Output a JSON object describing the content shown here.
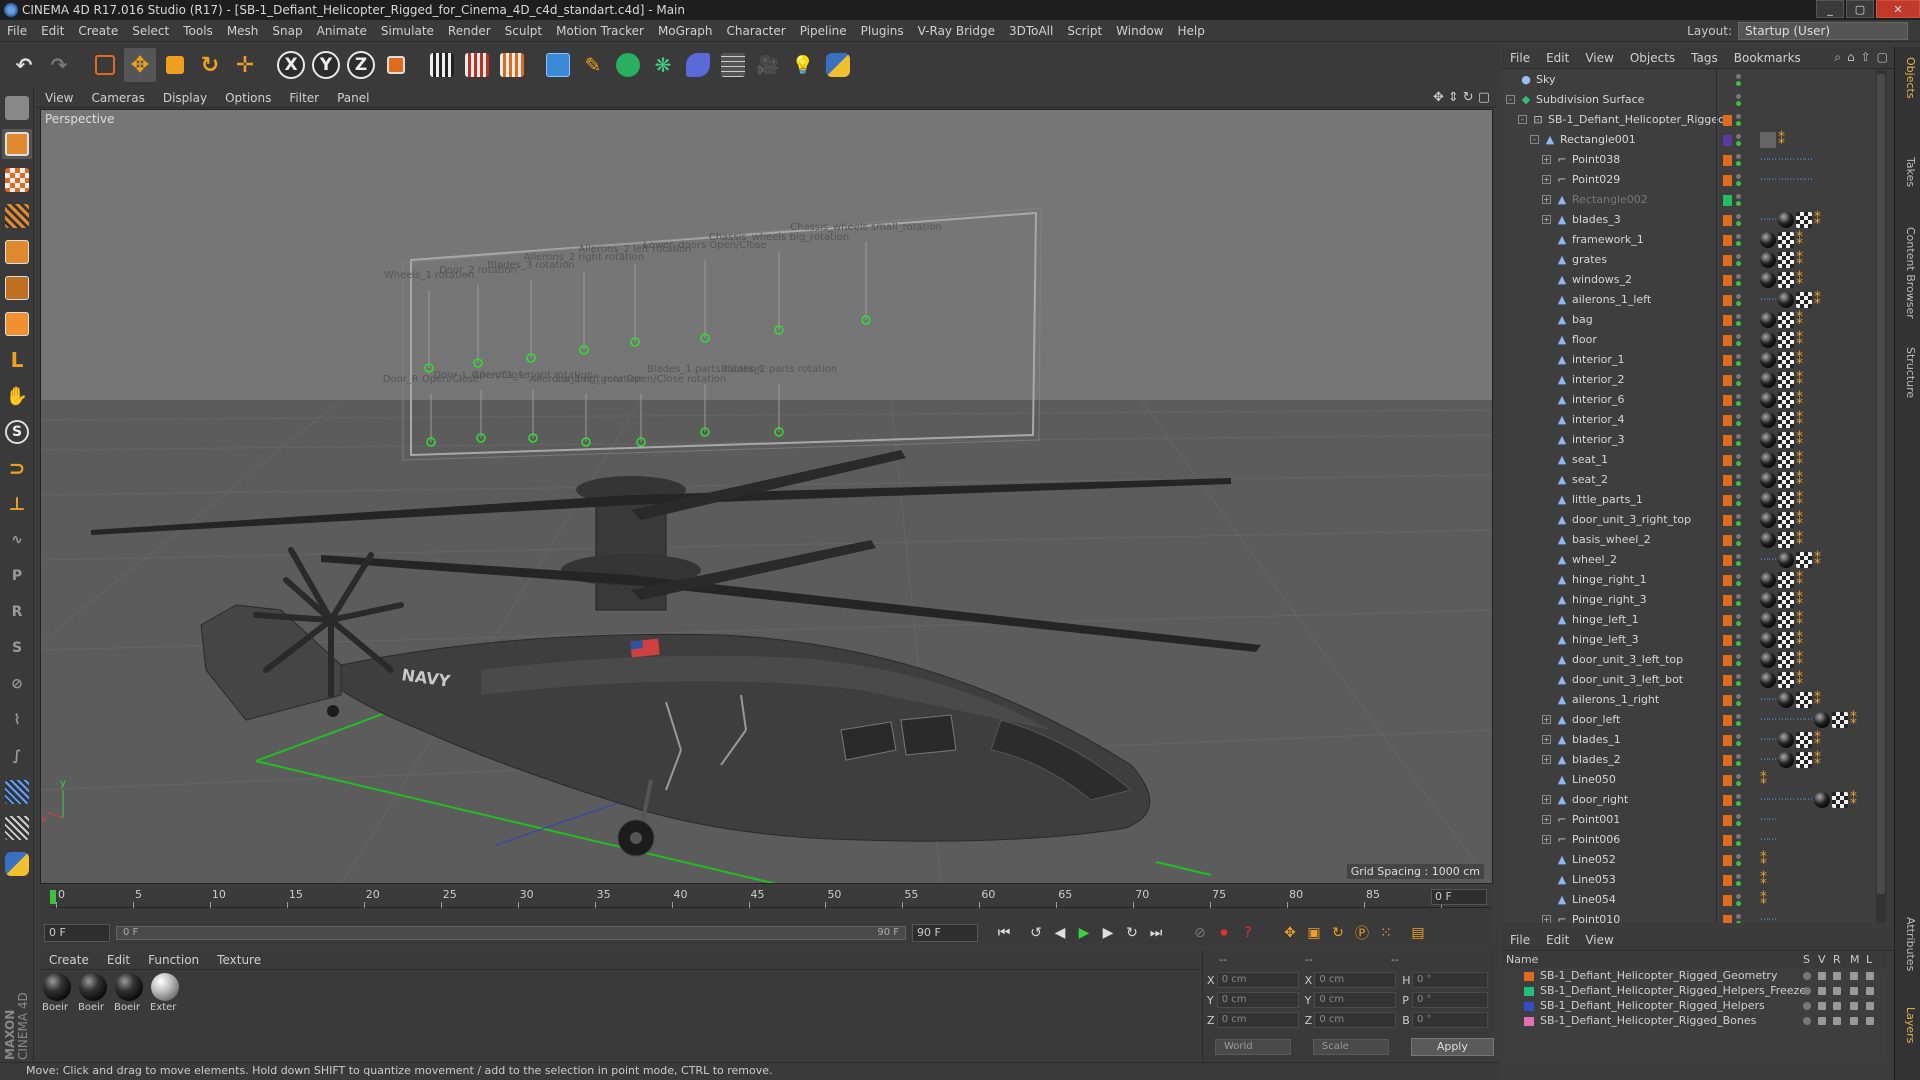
{
  "window": {
    "title": "CINEMA 4D R17.016 Studio (R17) - [SB-1_Defiant_Helicopter_Rigged_for_Cinema_4D_c4d_standart.c4d] - Main",
    "controls": [
      "_",
      "▢",
      "✕"
    ]
  },
  "menubar": {
    "items": [
      "File",
      "Edit",
      "Create",
      "Select",
      "Tools",
      "Mesh",
      "Snap",
      "Animate",
      "Simulate",
      "Render",
      "Sculpt",
      "Motion Tracker",
      "MoGraph",
      "Character",
      "Pipeline",
      "Plugins",
      "V-Ray Bridge",
      "3DToAll",
      "Script",
      "Window",
      "Help"
    ],
    "layout_label": "Layout:",
    "layout_value": "Startup (User)"
  },
  "toolbar": {
    "axis": [
      "X",
      "Y",
      "Z"
    ]
  },
  "viewport": {
    "menu": [
      "View",
      "Cameras",
      "Display",
      "Options",
      "Filter",
      "Panel"
    ],
    "label": "Perspective",
    "grid_spacing": "Grid Spacing : 1000 cm",
    "axis_y": "y",
    "axis_x": "x",
    "rig_labels": [
      "Wheels_1 rotation",
      "Door_2 rotation",
      "Blades_3 rotation",
      "Ailerons_2 right rotation",
      "Ailerons_2 left rotation",
      "Lower_doors Open/Close",
      "Chassis_wheels big_rotation",
      "Chassis_wheels small_rotation",
      "Door_R Open/Close",
      "Door_L Open/Close",
      "Ailerons_1 right rotation",
      "Ailerons_1 left rotation",
      "Landing_gear Open/Close rotation",
      "Blades_1 parts rotation",
      "Blades_2 parts rotation"
    ],
    "tail_text": "NAVY"
  },
  "timeline": {
    "ticks": [
      "0",
      "5",
      "10",
      "15",
      "20",
      "25",
      "30",
      "35",
      "40",
      "45",
      "50",
      "55",
      "60",
      "65",
      "70",
      "75",
      "80",
      "85",
      "90"
    ],
    "frame_end_field": "0 F",
    "current_frame": "0 F",
    "range_start": "0 F",
    "range_end_label": "90 F",
    "max_frame": "90 F"
  },
  "materials": {
    "menu": [
      "Create",
      "Edit",
      "Function",
      "Texture"
    ],
    "items": [
      {
        "name": "Boeir",
        "light": false
      },
      {
        "name": "Boeir",
        "light": false
      },
      {
        "name": "Boeir",
        "light": false
      },
      {
        "name": "Exter",
        "light": true
      }
    ]
  },
  "coordinates": {
    "headers": [
      "--",
      "--",
      "--"
    ],
    "rows": [
      {
        "a1": "X",
        "v1": "0 cm",
        "a2": "X",
        "v2": "0 cm",
        "a3": "H",
        "v3": "0 °"
      },
      {
        "a1": "Y",
        "v1": "0 cm",
        "a2": "Y",
        "v2": "0 cm",
        "a3": "P",
        "v3": "0 °"
      },
      {
        "a1": "Z",
        "v1": "0 cm",
        "a2": "Z",
        "v2": "0 cm",
        "a3": "B",
        "v3": "0 °"
      }
    ],
    "mode": "World",
    "scale": "Scale",
    "apply": "Apply"
  },
  "status": "Move: Click and drag to move elements. Hold down SHIFT to quantize movement / add to the selection in point mode, CTRL to remove.",
  "object_manager": {
    "menu": [
      "File",
      "Edit",
      "View",
      "Objects",
      "Tags",
      "Bookmarks"
    ],
    "objects": [
      {
        "name": "Sky",
        "indent": 0,
        "exp": "",
        "icon": "sky",
        "layer": "",
        "tags": []
      },
      {
        "name": "Subdivision Surface",
        "indent": 0,
        "exp": "-",
        "icon": "subd",
        "layer": "",
        "tags": []
      },
      {
        "name": "SB-1_Defiant_Helicopter_Rigged",
        "indent": 1,
        "exp": "-",
        "icon": "null",
        "layer": "#e06a1e",
        "tags": []
      },
      {
        "name": "Rectangle001",
        "indent": 2,
        "exp": "-",
        "icon": "poly",
        "layer": "#5a3aa0",
        "tags": [
          "ph",
          "or"
        ]
      },
      {
        "name": "Point038",
        "indent": 3,
        "exp": "+",
        "icon": "spline",
        "layer": "#e06a1e",
        "tags": [
          "dots",
          "dots",
          "dots"
        ]
      },
      {
        "name": "Point029",
        "indent": 3,
        "exp": "+",
        "icon": "spline",
        "layer": "#e06a1e",
        "tags": [
          "dots",
          "dots",
          "dots"
        ]
      },
      {
        "name": "Rectangle002",
        "indent": 3,
        "exp": "+",
        "icon": "poly",
        "layer": "#20c060",
        "tags": [],
        "dim": true
      },
      {
        "name": "blades_3",
        "indent": 3,
        "exp": "+",
        "icon": "poly",
        "layer": "#e06a1e",
        "tags": [
          "dots",
          "mat-b",
          "chk",
          "or"
        ]
      },
      {
        "name": "framework_1",
        "indent": 3,
        "exp": "",
        "icon": "poly",
        "layer": "#e06a1e",
        "tags": [
          "mat-b",
          "chk",
          "or"
        ]
      },
      {
        "name": "grates",
        "indent": 3,
        "exp": "",
        "icon": "poly",
        "layer": "#e06a1e",
        "tags": [
          "mat-b",
          "chk",
          "or"
        ]
      },
      {
        "name": "windows_2",
        "indent": 3,
        "exp": "",
        "icon": "poly",
        "layer": "#e06a1e",
        "tags": [
          "mat-b",
          "chk",
          "or"
        ]
      },
      {
        "name": "ailerons_1_left",
        "indent": 3,
        "exp": "",
        "icon": "poly",
        "layer": "#e06a1e",
        "tags": [
          "dots",
          "mat-b",
          "chk",
          "or"
        ]
      },
      {
        "name": "bag",
        "indent": 3,
        "exp": "",
        "icon": "poly",
        "layer": "#e06a1e",
        "tags": [
          "mat-b",
          "chk",
          "or"
        ]
      },
      {
        "name": "floor",
        "indent": 3,
        "exp": "",
        "icon": "poly",
        "layer": "#e06a1e",
        "tags": [
          "mat-b",
          "chk",
          "or"
        ]
      },
      {
        "name": "interior_1",
        "indent": 3,
        "exp": "",
        "icon": "poly",
        "layer": "#e06a1e",
        "tags": [
          "mat-b",
          "chk",
          "or"
        ]
      },
      {
        "name": "interior_2",
        "indent": 3,
        "exp": "",
        "icon": "poly",
        "layer": "#e06a1e",
        "tags": [
          "mat-b",
          "chk",
          "or"
        ]
      },
      {
        "name": "interior_6",
        "indent": 3,
        "exp": "",
        "icon": "poly",
        "layer": "#e06a1e",
        "tags": [
          "mat-b",
          "chk",
          "or"
        ]
      },
      {
        "name": "interior_4",
        "indent": 3,
        "exp": "",
        "icon": "poly",
        "layer": "#e06a1e",
        "tags": [
          "mat-b",
          "chk",
          "or"
        ]
      },
      {
        "name": "interior_3",
        "indent": 3,
        "exp": "",
        "icon": "poly",
        "layer": "#e06a1e",
        "tags": [
          "mat-b",
          "chk",
          "or"
        ]
      },
      {
        "name": "seat_1",
        "indent": 3,
        "exp": "",
        "icon": "poly",
        "layer": "#e06a1e",
        "tags": [
          "mat-b",
          "chk",
          "or"
        ]
      },
      {
        "name": "seat_2",
        "indent": 3,
        "exp": "",
        "icon": "poly",
        "layer": "#e06a1e",
        "tags": [
          "mat-b",
          "chk",
          "or"
        ]
      },
      {
        "name": "little_parts_1",
        "indent": 3,
        "exp": "",
        "icon": "poly",
        "layer": "#e06a1e",
        "tags": [
          "mat-b",
          "chk",
          "or"
        ]
      },
      {
        "name": "door_unit_3_right_top",
        "indent": 3,
        "exp": "",
        "icon": "poly",
        "layer": "#e06a1e",
        "tags": [
          "mat-b",
          "chk",
          "or"
        ]
      },
      {
        "name": "basis_wheel_2",
        "indent": 3,
        "exp": "",
        "icon": "poly",
        "layer": "#e06a1e",
        "tags": [
          "mat-b",
          "chk",
          "or"
        ]
      },
      {
        "name": "wheel_2",
        "indent": 3,
        "exp": "",
        "icon": "poly",
        "layer": "#e06a1e",
        "tags": [
          "dots",
          "mat-b",
          "chk",
          "or"
        ]
      },
      {
        "name": "hinge_right_1",
        "indent": 3,
        "exp": "",
        "icon": "poly",
        "layer": "#e06a1e",
        "tags": [
          "mat-b",
          "chk",
          "or"
        ]
      },
      {
        "name": "hinge_right_3",
        "indent": 3,
        "exp": "",
        "icon": "poly",
        "layer": "#e06a1e",
        "tags": [
          "mat-b",
          "chk",
          "or"
        ]
      },
      {
        "name": "hinge_left_1",
        "indent": 3,
        "exp": "",
        "icon": "poly",
        "layer": "#e06a1e",
        "tags": [
          "mat-b",
          "chk",
          "or"
        ]
      },
      {
        "name": "hinge_left_3",
        "indent": 3,
        "exp": "",
        "icon": "poly",
        "layer": "#e06a1e",
        "tags": [
          "mat-b",
          "chk",
          "or"
        ]
      },
      {
        "name": "door_unit_3_left_top",
        "indent": 3,
        "exp": "",
        "icon": "poly",
        "layer": "#e06a1e",
        "tags": [
          "mat-b",
          "chk",
          "or"
        ]
      },
      {
        "name": "door_unit_3_left_bot",
        "indent": 3,
        "exp": "",
        "icon": "poly",
        "layer": "#e06a1e",
        "tags": [
          "mat-b",
          "chk",
          "or"
        ]
      },
      {
        "name": "ailerons_1_right",
        "indent": 3,
        "exp": "",
        "icon": "poly",
        "layer": "#e06a1e",
        "tags": [
          "dots",
          "mat-b",
          "chk",
          "or"
        ]
      },
      {
        "name": "door_left",
        "indent": 3,
        "exp": "+",
        "icon": "poly",
        "layer": "#e06a1e",
        "tags": [
          "dots",
          "dots",
          "dots",
          "mat-b",
          "chk",
          "or"
        ]
      },
      {
        "name": "blades_1",
        "indent": 3,
        "exp": "+",
        "icon": "poly",
        "layer": "#e06a1e",
        "tags": [
          "dots",
          "mat-b",
          "chk",
          "or"
        ]
      },
      {
        "name": "blades_2",
        "indent": 3,
        "exp": "+",
        "icon": "poly",
        "layer": "#e06a1e",
        "tags": [
          "dots",
          "mat-b",
          "chk",
          "or"
        ]
      },
      {
        "name": "Line050",
        "indent": 3,
        "exp": "",
        "icon": "poly",
        "layer": "#e06a1e",
        "tags": [
          "or"
        ]
      },
      {
        "name": "door_right",
        "indent": 3,
        "exp": "+",
        "icon": "poly",
        "layer": "#e06a1e",
        "tags": [
          "dots",
          "dots",
          "dots",
          "mat-b",
          "chk",
          "or"
        ]
      },
      {
        "name": "Point001",
        "indent": 3,
        "exp": "+",
        "icon": "spline",
        "layer": "#e06a1e",
        "tags": [
          "dots"
        ]
      },
      {
        "name": "Point006",
        "indent": 3,
        "exp": "+",
        "icon": "spline",
        "layer": "#e06a1e",
        "tags": [
          "dots"
        ]
      },
      {
        "name": "Line052",
        "indent": 3,
        "exp": "",
        "icon": "poly",
        "layer": "#e06a1e",
        "tags": [
          "or"
        ]
      },
      {
        "name": "Line053",
        "indent": 3,
        "exp": "",
        "icon": "poly",
        "layer": "#e06a1e",
        "tags": [
          "or"
        ]
      },
      {
        "name": "Line054",
        "indent": 3,
        "exp": "",
        "icon": "poly",
        "layer": "#e06a1e",
        "tags": [
          "or"
        ]
      },
      {
        "name": "Point010",
        "indent": 3,
        "exp": "+",
        "icon": "spline",
        "layer": "#e06a1e",
        "tags": [
          "dots"
        ]
      }
    ]
  },
  "layer_manager": {
    "menu": [
      "File",
      "Edit",
      "View"
    ],
    "header": {
      "name": "Name",
      "cols": [
        "S",
        "V",
        "R",
        "M",
        "L"
      ]
    },
    "layers": [
      {
        "name": "SB-1_Defiant_Helicopter_Rigged_Geometry",
        "color": "#e06a1e"
      },
      {
        "name": "SB-1_Defiant_Helicopter_Rigged_Helpers_Freeze",
        "color": "#20c080"
      },
      {
        "name": "SB-1_Defiant_Helicopter_Rigged_Helpers",
        "color": "#3050c0"
      },
      {
        "name": "SB-1_Defiant_Helicopter_Rigged_Bones",
        "color": "#e070b0"
      }
    ]
  },
  "side_tabs": [
    "Objects",
    "Takes",
    "Content Browser",
    "Structure",
    "Attributes",
    "Layers"
  ],
  "maxon_logo": {
    "line1": "MAXON",
    "line2": "CINEMA 4D"
  }
}
